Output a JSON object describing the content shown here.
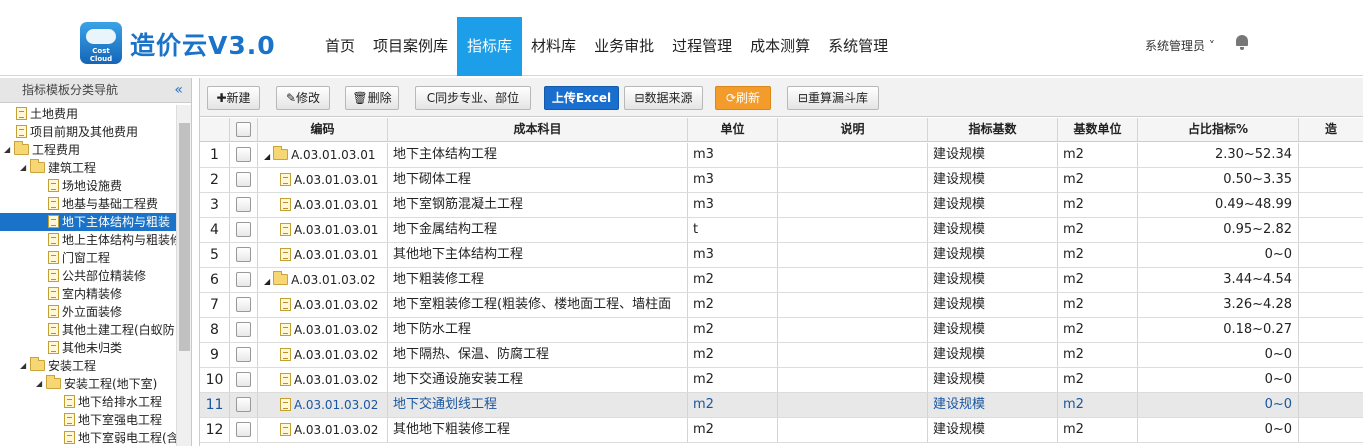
{
  "header": {
    "logo_text_1": "Cost",
    "logo_text_2": "Cloud",
    "brand": "造价云V3.0",
    "nav": [
      "首页",
      "项目案例库",
      "指标库",
      "材料库",
      "业务审批",
      "过程管理",
      "成本测算",
      "系统管理"
    ],
    "active_nav": "指标库",
    "user": "系统管理员 ˅"
  },
  "sidebar": {
    "title": "指标模板分类导航",
    "collapse_glyph": "«",
    "tree": [
      {
        "label": "土地费用",
        "level": 0,
        "type": "file"
      },
      {
        "label": "项目前期及其他费用",
        "level": 0,
        "type": "file"
      },
      {
        "label": "工程费用",
        "level": 0,
        "type": "folder",
        "expanded": true
      },
      {
        "label": "建筑工程",
        "level": 1,
        "type": "folder",
        "expanded": true
      },
      {
        "label": "场地设施费",
        "level": 2,
        "type": "file"
      },
      {
        "label": "地基与基础工程费",
        "level": 2,
        "type": "file"
      },
      {
        "label": "地下主体结构与粗装",
        "level": 2,
        "type": "file",
        "selected": true
      },
      {
        "label": "地上主体结构与粗装修",
        "level": 2,
        "type": "file"
      },
      {
        "label": "门窗工程",
        "level": 2,
        "type": "file"
      },
      {
        "label": "公共部位精装修",
        "level": 2,
        "type": "file"
      },
      {
        "label": "室内精装修",
        "level": 2,
        "type": "file"
      },
      {
        "label": "外立面装修",
        "level": 2,
        "type": "file"
      },
      {
        "label": "其他土建工程(白蚁防",
        "level": 2,
        "type": "file"
      },
      {
        "label": "其他未归类",
        "level": 2,
        "type": "file"
      },
      {
        "label": "安装工程",
        "level": 1,
        "type": "folder",
        "expanded": true
      },
      {
        "label": "安装工程(地下室)",
        "level": 2,
        "type": "folder",
        "expanded": true
      },
      {
        "label": "地下给排水工程",
        "level": 3,
        "type": "file"
      },
      {
        "label": "地下室强电工程",
        "level": 3,
        "type": "file"
      },
      {
        "label": "地下室弱电工程(含",
        "level": 3,
        "type": "file"
      }
    ]
  },
  "toolbar": {
    "new": "✚新建",
    "edit": "✎修改",
    "delete": "🗑删除",
    "sync": "C同步专业、部位",
    "upload": "上传Excel",
    "source": "⊟数据来源",
    "refresh": "⟳刷新",
    "recalc": "⊟重算漏斗库"
  },
  "table": {
    "headers": [
      "",
      "",
      "编码",
      "成本科目",
      "单位",
      "说明",
      "指标基数",
      "基数单位",
      "占比指标%",
      "造"
    ],
    "rows": [
      {
        "no": "1",
        "code": "A.03.01.03.01",
        "folder": true,
        "subject": "地下主体结构工程",
        "unit": "m3",
        "note": "",
        "base": "建设规模",
        "base_unit": "m2",
        "ratio": "2.30~52.34"
      },
      {
        "no": "2",
        "code": "A.03.01.03.01",
        "folder": false,
        "subject": "地下砌体工程",
        "unit": "m3",
        "note": "",
        "base": "建设规模",
        "base_unit": "m2",
        "ratio": "0.50~3.35"
      },
      {
        "no": "3",
        "code": "A.03.01.03.01",
        "folder": false,
        "subject": "地下室钢筋混凝土工程",
        "unit": "m3",
        "note": "",
        "base": "建设规模",
        "base_unit": "m2",
        "ratio": "0.49~48.99"
      },
      {
        "no": "4",
        "code": "A.03.01.03.01",
        "folder": false,
        "subject": "地下金属结构工程",
        "unit": "t",
        "note": "",
        "base": "建设规模",
        "base_unit": "m2",
        "ratio": "0.95~2.82"
      },
      {
        "no": "5",
        "code": "A.03.01.03.01",
        "folder": false,
        "subject": "其他地下主体结构工程",
        "unit": "m3",
        "note": "",
        "base": "建设规模",
        "base_unit": "m2",
        "ratio": "0~0"
      },
      {
        "no": "6",
        "code": "A.03.01.03.02",
        "folder": true,
        "subject": "地下粗装修工程",
        "unit": "m2",
        "note": "",
        "base": "建设规模",
        "base_unit": "m2",
        "ratio": "3.44~4.54"
      },
      {
        "no": "7",
        "code": "A.03.01.03.02",
        "folder": false,
        "subject": "地下室粗装修工程(粗装修、楼地面工程、墙柱面",
        "unit": "m2",
        "note": "",
        "base": "建设规模",
        "base_unit": "m2",
        "ratio": "3.26~4.28"
      },
      {
        "no": "8",
        "code": "A.03.01.03.02",
        "folder": false,
        "subject": "地下防水工程",
        "unit": "m2",
        "note": "",
        "base": "建设规模",
        "base_unit": "m2",
        "ratio": "0.18~0.27"
      },
      {
        "no": "9",
        "code": "A.03.01.03.02",
        "folder": false,
        "subject": "地下隔热、保温、防腐工程",
        "unit": "m2",
        "note": "",
        "base": "建设规模",
        "base_unit": "m2",
        "ratio": "0~0"
      },
      {
        "no": "10",
        "code": "A.03.01.03.02",
        "folder": false,
        "subject": "地下交通设施安装工程",
        "unit": "m2",
        "note": "",
        "base": "建设规模",
        "base_unit": "m2",
        "ratio": "0~0"
      },
      {
        "no": "11",
        "code": "A.03.01.03.02",
        "folder": false,
        "subject": "地下交通划线工程",
        "unit": "m2",
        "note": "",
        "base": "建设规模",
        "base_unit": "m2",
        "ratio": "0~0",
        "highlight": true
      },
      {
        "no": "12",
        "code": "A.03.01.03.02",
        "folder": false,
        "subject": "其他地下粗装修工程",
        "unit": "m2",
        "note": "",
        "base": "建设规模",
        "base_unit": "m2",
        "ratio": "0~0"
      }
    ]
  },
  "colors": {
    "accent": "#1d9ee8",
    "brand": "#1a73c8",
    "upload_button": "#1a6fce",
    "refresh_button": "#f39c2b"
  }
}
